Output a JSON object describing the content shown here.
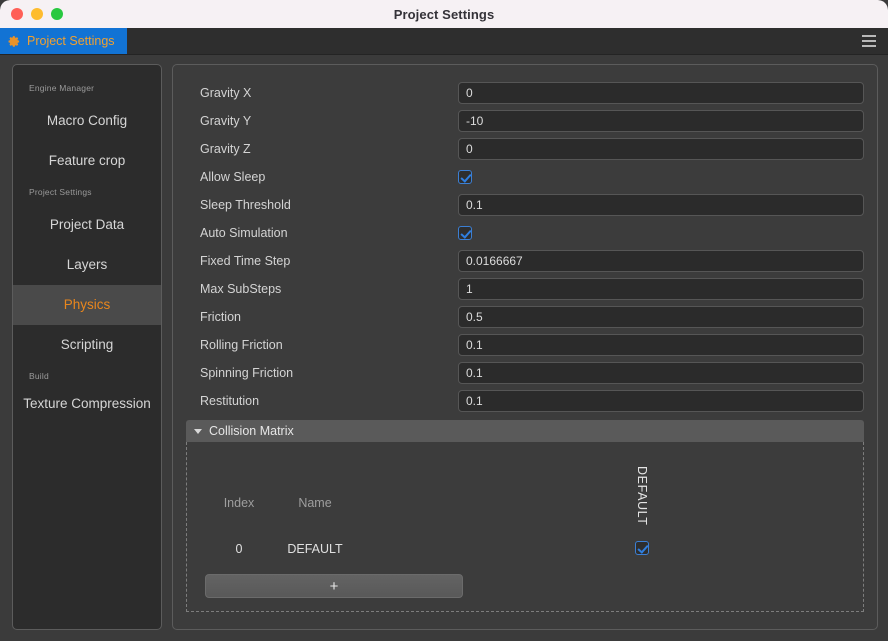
{
  "window": {
    "title": "Project Settings",
    "traffic_lights": [
      "close",
      "minimize",
      "zoom"
    ]
  },
  "tabbar": {
    "tab_label": "Project Settings",
    "tab_icon": "gear-icon",
    "menu_icon": "hamburger-menu-icon",
    "active_tab_bg": "#1273d4",
    "active_tab_fg": "#f0a030"
  },
  "sidebar": {
    "groups": [
      {
        "label": "Engine Manager",
        "items": [
          {
            "label": "Macro Config",
            "active": false
          },
          {
            "label": "Feature crop",
            "active": false
          }
        ]
      },
      {
        "label": "Project Settings",
        "items": [
          {
            "label": "Project Data",
            "active": false
          },
          {
            "label": "Layers",
            "active": false
          },
          {
            "label": "Physics",
            "active": true
          },
          {
            "label": "Scripting",
            "active": false
          }
        ]
      },
      {
        "label": "Build",
        "items": [
          {
            "label": "Texture Compression",
            "active": false
          }
        ]
      }
    ],
    "active_color": "#e8861d"
  },
  "settings": {
    "fields": [
      {
        "label": "Gravity X",
        "type": "text",
        "value": "0"
      },
      {
        "label": "Gravity Y",
        "type": "text",
        "value": "-10"
      },
      {
        "label": "Gravity Z",
        "type": "text",
        "value": "0"
      },
      {
        "label": "Allow Sleep",
        "type": "checkbox",
        "checked": true
      },
      {
        "label": "Sleep Threshold",
        "type": "text",
        "value": "0.1"
      },
      {
        "label": "Auto Simulation",
        "type": "checkbox",
        "checked": true
      },
      {
        "label": "Fixed Time Step",
        "type": "text",
        "value": "0.0166667"
      },
      {
        "label": "Max SubSteps",
        "type": "text",
        "value": "1"
      },
      {
        "label": "Friction",
        "type": "text",
        "value": "0.5"
      },
      {
        "label": "Rolling Friction",
        "type": "text",
        "value": "0.1"
      },
      {
        "label": "Spinning Friction",
        "type": "text",
        "value": "0.1"
      },
      {
        "label": "Restitution",
        "type": "text",
        "value": "0.1"
      }
    ]
  },
  "collision_matrix": {
    "title": "Collision Matrix",
    "expanded": true,
    "columns": [
      "Index",
      "Name"
    ],
    "matrix_columns": [
      "DEFAULT"
    ],
    "rows": [
      {
        "index": "0",
        "name": "DEFAULT",
        "checks": [
          true
        ]
      }
    ],
    "add_button_label": "+"
  }
}
